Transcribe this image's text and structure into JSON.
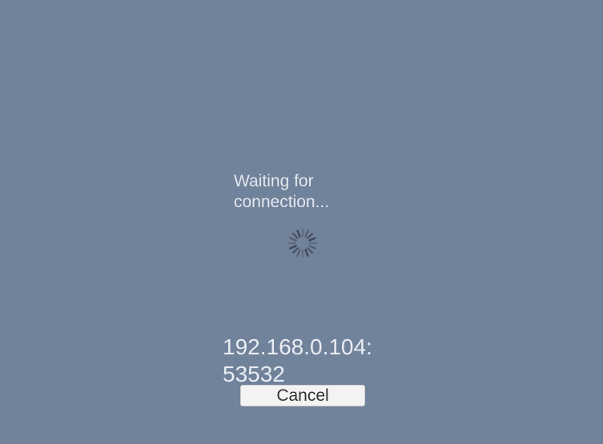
{
  "connection": {
    "status_text": "Waiting for\nconnection...",
    "address_text": "192.168.0.104:\n53532",
    "cancel_label": "Cancel"
  },
  "spinner": {
    "icon": "loading-spinner-icon",
    "color": "#3e4350"
  },
  "colors": {
    "background": "#71829b",
    "text": "#e3e7ee",
    "button_bg": "#f3f3f3",
    "button_text": "#333333"
  }
}
